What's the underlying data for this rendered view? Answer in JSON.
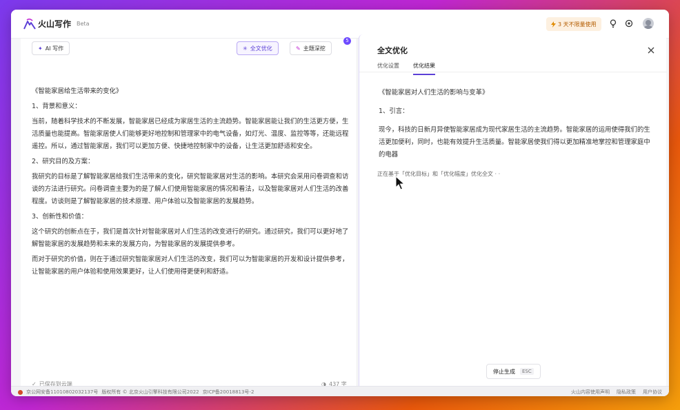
{
  "app": {
    "name": "火山写作",
    "badge": "Beta"
  },
  "header": {
    "trial_text": "3 天不限量使用"
  },
  "toolbar": {
    "ai_write": "AI 写作",
    "full_optimize": "全文优化",
    "topic_deepen": "主题深挖",
    "badge_count": "5"
  },
  "doc": {
    "paragraphs": [
      "《智能家居给生活带来的变化》",
      "1、背景和意义：",
      "当前，随着科学技术的不断发展，智能家居已经成为家居生活的主流趋势。智能家居能让我们的生活更方便，生活质量也能提高。智能家居使人们能够更好地控制和管理家中的电气设备，如灯光、温度、监控等等，还能远程遥控。所以，通过智能家居，我们可以更加方便、快捷地控制家中的设备，让生活更加舒适和安全。",
      "2、研究目的及方案：",
      "我研究的目标是了解智能家居给我们生活带来的变化，研究智能家居对生活的影响。本研究会采用问卷调查和访谈的方法进行研究。问卷调查主要为的是了解人们使用智能家居的情况和看法，以及智能家居对人们生活的改善程度。访谈则是了解智能家居的技术原理、用户体验以及智能家居的发展趋势。",
      "3、创新性和价值：",
      "这个研究的创新点在于，我们是首次针对智能家居对人们生活的改变进行的研究。通过研究，我们可以更好地了解智能家居的发展趋势和未来的发展方向，为智能家居的发展提供参考。",
      "而对于研究的价值，则在于通过研究智能家居对人们生活的改变，我们可以为智能家居的开发和设计提供参考，让智能家居的用户体验和使用效果更好，让人们使用得更便利和舒适。"
    ],
    "saved_status": "已保存到云端",
    "word_count": "437 字"
  },
  "panel": {
    "title": "全文优化",
    "tabs": [
      "优化设置",
      "优化结果"
    ],
    "result_paragraphs": [
      "《智能家居对人们生活的影响与变革》",
      "1、引言：",
      "现今，科技的日新月异使智能家居成为现代家居生活的主流趋势。智能家居的运用使得我们的生活更加便利，同时，也能有效提升生活质量。智能家居使我们得以更加精准地掌控和管理家庭中的电器"
    ],
    "progress": "正在基于「优化目标」和「优化幅度」优化全文 · ·",
    "stop_label": "停止生成",
    "esc_label": "ESC"
  },
  "footer": {
    "left": [
      "京公网安备11010802032137号",
      "版权所有 © 北京火山引擎科技有限公司2022",
      "京ICP备20018813号-2"
    ],
    "right": [
      "火山内容使用声明",
      "隐私政策",
      "用户协议"
    ]
  },
  "colors": {
    "accent": "#5b3fd6",
    "trial_bg": "#fdf0e0",
    "trial_text": "#b35c00"
  }
}
